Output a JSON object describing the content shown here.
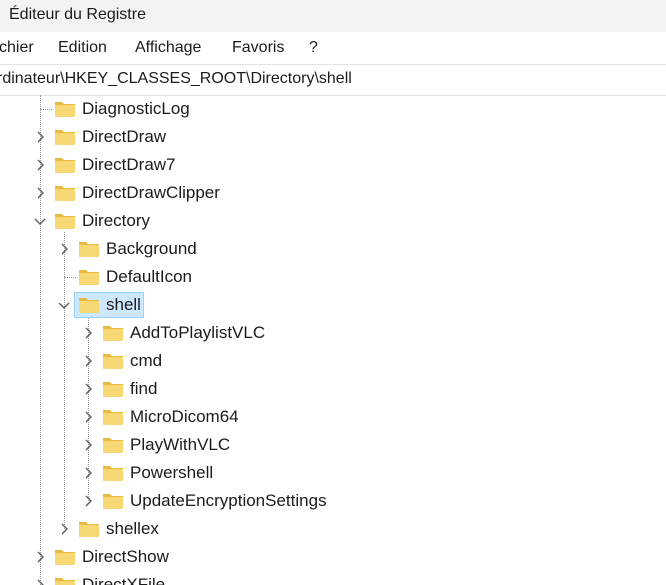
{
  "window": {
    "title": "Éditeur du Registre"
  },
  "menu": {
    "items": [
      "chier",
      "Edition",
      "Affichage",
      "Favoris",
      "?"
    ]
  },
  "address": {
    "path": "rdinateur\\HKEY_CLASSES_ROOT\\Directory\\shell"
  },
  "tree": {
    "nodes": [
      {
        "label": "DiagnosticLog",
        "level": 1,
        "expander": "none"
      },
      {
        "label": "DirectDraw",
        "level": 1,
        "expander": "collapsed"
      },
      {
        "label": "DirectDraw7",
        "level": 1,
        "expander": "collapsed"
      },
      {
        "label": "DirectDrawClipper",
        "level": 1,
        "expander": "collapsed"
      },
      {
        "label": "Directory",
        "level": 1,
        "expander": "expanded"
      },
      {
        "label": "Background",
        "level": 2,
        "expander": "collapsed"
      },
      {
        "label": "DefaultIcon",
        "level": 2,
        "expander": "none"
      },
      {
        "label": "shell",
        "level": 2,
        "expander": "expanded",
        "selected": true
      },
      {
        "label": "AddToPlaylistVLC",
        "level": 3,
        "expander": "collapsed"
      },
      {
        "label": "cmd",
        "level": 3,
        "expander": "collapsed"
      },
      {
        "label": "find",
        "level": 3,
        "expander": "collapsed"
      },
      {
        "label": "MicroDicom64",
        "level": 3,
        "expander": "collapsed"
      },
      {
        "label": "PlayWithVLC",
        "level": 3,
        "expander": "collapsed"
      },
      {
        "label": "Powershell",
        "level": 3,
        "expander": "collapsed"
      },
      {
        "label": "UpdateEncryptionSettings",
        "level": 3,
        "expander": "collapsed"
      },
      {
        "label": "shellex",
        "level": 2,
        "expander": "collapsed"
      },
      {
        "label": "DirectShow",
        "level": 1,
        "expander": "collapsed"
      },
      {
        "label": "DirectXFile",
        "level": 1,
        "expander": "collapsed"
      }
    ]
  },
  "colors": {
    "folder_fill": "#f8d775",
    "folder_tab": "#e8b941",
    "selection_bg": "#cce8ff",
    "selection_border": "#99d1ff",
    "chrome_bg": "#f3f3f3"
  }
}
